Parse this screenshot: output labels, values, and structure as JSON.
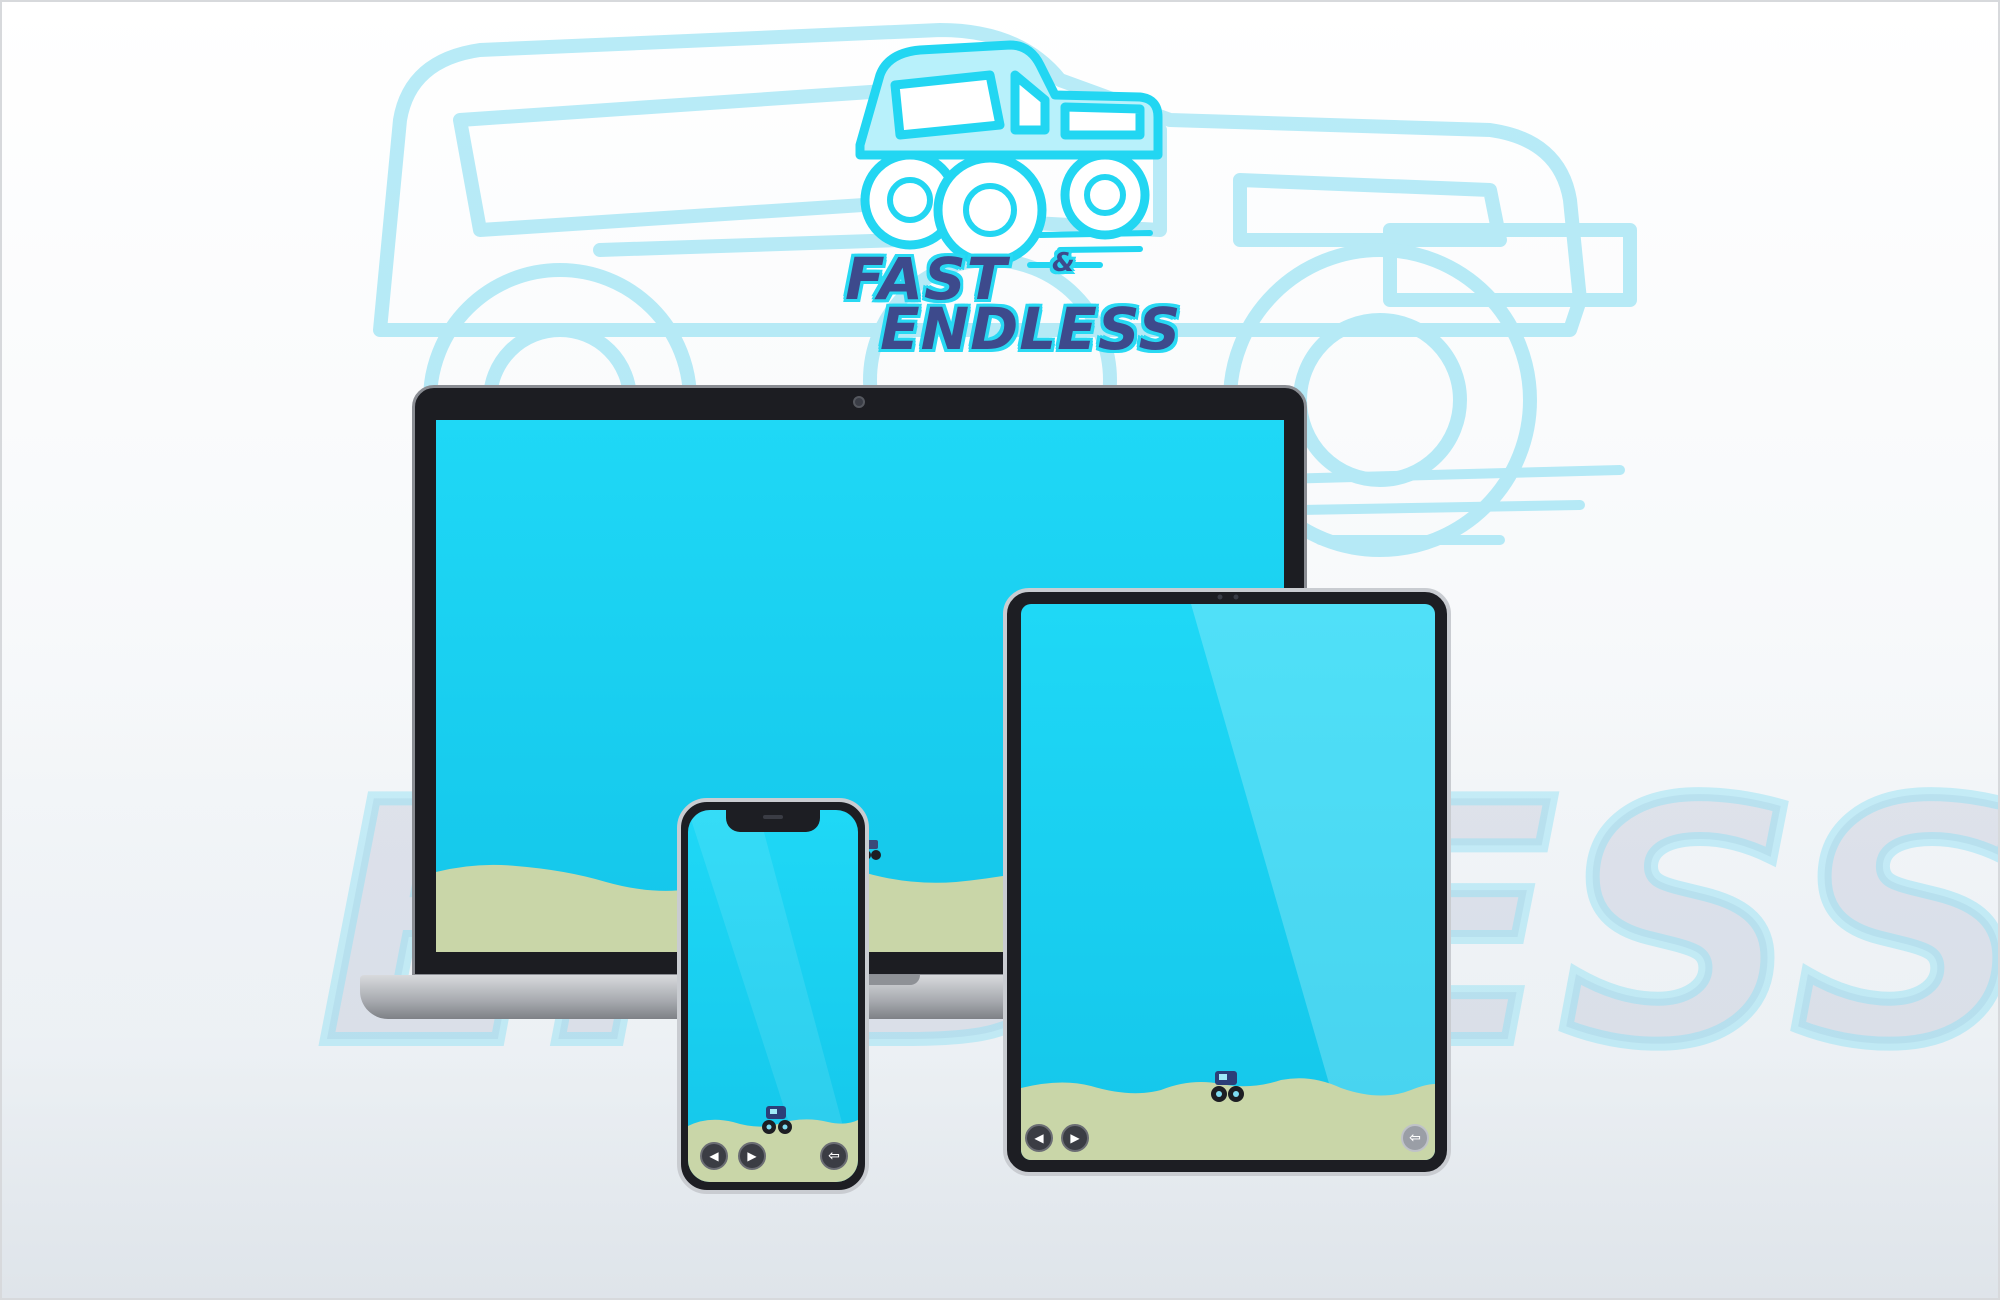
{
  "logo": {
    "title_line1": "FAST",
    "title_amp": "&",
    "title_line2": "ENDLESS",
    "icon": "monster-truck-icon"
  },
  "background": {
    "watermark_text": "ENDLESS",
    "watermark_icon": "monster-truck-icon"
  },
  "colors": {
    "sky": "#1fd8f6",
    "sand": "#c9d6a8",
    "logo_text": "#3d4a8c",
    "logo_outline": "#28d9f3",
    "control_button": "#3b3d44"
  },
  "devices": {
    "laptop": {
      "name": "laptop",
      "vehicle_icon": "monster-truck-icon"
    },
    "tablet": {
      "name": "tablet",
      "controls": {
        "left": "left-arrow-icon",
        "right": "right-arrow-icon",
        "back": "back-arrow-icon"
      }
    },
    "phone": {
      "name": "phone",
      "controls": {
        "left": "left-arrow-icon",
        "right": "right-arrow-icon",
        "back": "back-arrow-icon"
      }
    }
  },
  "glyphs": {
    "left": "◀",
    "right": "▶",
    "back": "⇦"
  }
}
